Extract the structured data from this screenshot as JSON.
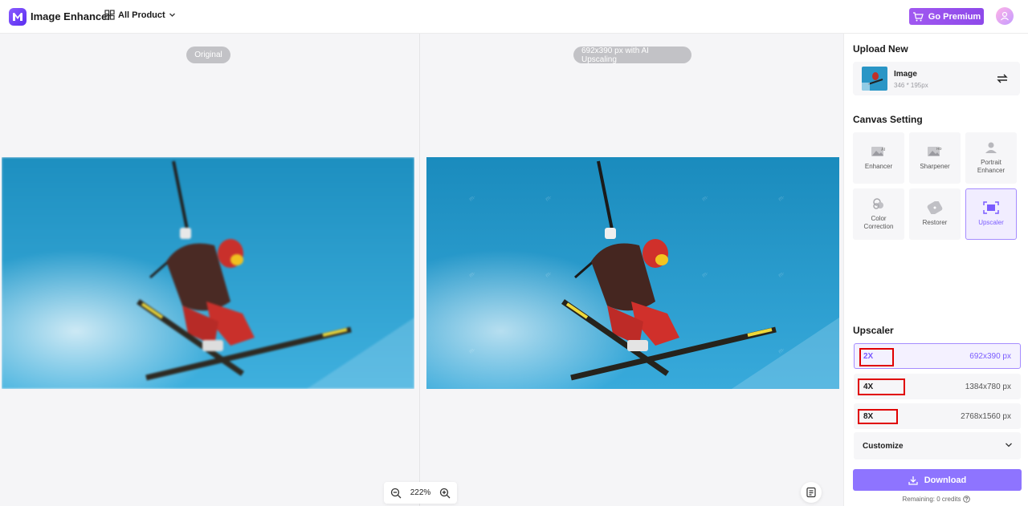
{
  "header": {
    "app_title": "Image Enhancer",
    "all_product": "All Product",
    "go_premium": "Go Premium"
  },
  "canvas": {
    "original_label": "Original",
    "result_label": "692x390 px with AI Upscaling",
    "zoom_level": "222%"
  },
  "panel": {
    "upload_title": "Upload New",
    "upload_name": "Image",
    "upload_size": "346 * 195px",
    "canvas_title": "Canvas Setting",
    "tools": [
      {
        "label": "Enhancer",
        "icon": "enhancer-icon"
      },
      {
        "label": "Sharpener",
        "icon": "sharpener-icon"
      },
      {
        "label": "Portrait Enhancer",
        "icon": "portrait-icon"
      },
      {
        "label": "Color Correction",
        "icon": "color-correction-icon"
      },
      {
        "label": "Restorer",
        "icon": "restorer-icon"
      },
      {
        "label": "Upscaler",
        "icon": "upscaler-icon"
      }
    ],
    "active_tool": "Upscaler",
    "upscaler_title": "Upscaler",
    "scales": [
      {
        "label": "2X",
        "value": "692x390 px"
      },
      {
        "label": "4X",
        "value": "1384x780 px"
      },
      {
        "label": "8X",
        "value": "2768x1560 px"
      }
    ],
    "selected_scale": "2X",
    "customize_label": "Customize",
    "download_label": "Download",
    "remaining_text": "Remaining: 0 credits"
  },
  "colors": {
    "accent": "#8e74ff",
    "premium": "#9b51e0",
    "highlight_box": "#e00000"
  }
}
